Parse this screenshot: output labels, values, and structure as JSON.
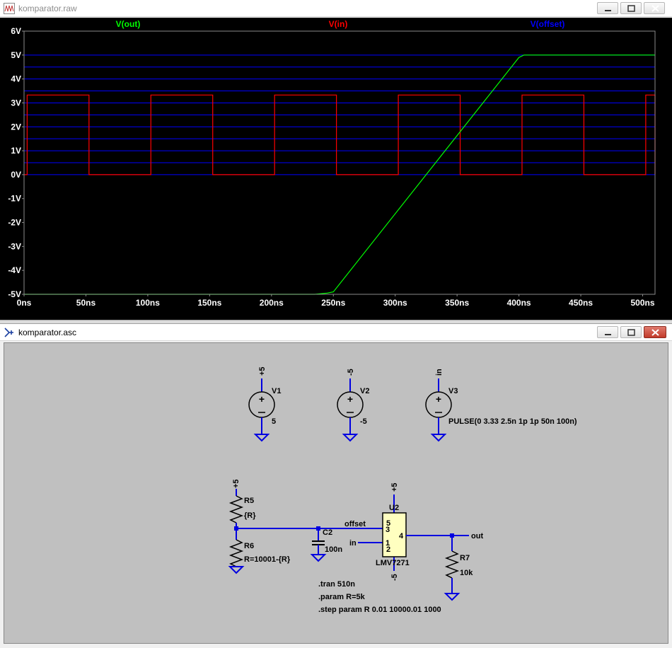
{
  "plot_window": {
    "title": "komparator.raw",
    "title_color": "#8c8c8c"
  },
  "schematic_window": {
    "title": "komparator.asc",
    "title_color": "#000000"
  },
  "chart_data": {
    "type": "line",
    "background": "#000000",
    "grid": "horizontal-only",
    "xlim": [
      0,
      510
    ],
    "ylim": [
      -5,
      6
    ],
    "x_tick_labels": [
      "0ns",
      "50ns",
      "100ns",
      "150ns",
      "200ns",
      "250ns",
      "300ns",
      "350ns",
      "400ns",
      "450ns",
      "500ns"
    ],
    "y_tick_labels": [
      "6V",
      "5V",
      "4V",
      "3V",
      "2V",
      "1V",
      "0V",
      "-1V",
      "-2V",
      "-3V",
      "-4V",
      "-5V"
    ],
    "legend": [
      {
        "label": "V(out)",
        "color": "#00ff00"
      },
      {
        "label": "V(in)",
        "color": "#ff0000"
      },
      {
        "label": "V(offset)",
        "color": "#0000ff"
      }
    ],
    "series": [
      {
        "name": "V(out)",
        "color": "#00ff00",
        "points": [
          [
            0,
            -5
          ],
          [
            235,
            -5
          ],
          [
            245,
            -4.95
          ],
          [
            250,
            -4.9
          ],
          [
            400,
            4.9
          ],
          [
            404,
            5
          ],
          [
            510,
            5
          ]
        ]
      },
      {
        "name": "V(in)",
        "color": "#ff0000",
        "pulse": {
          "v1": 0,
          "v2": 3.33,
          "delay": 2.5,
          "rise": 0,
          "fall": 0,
          "width": 50,
          "period": 100
        }
      },
      {
        "name": "V(offset)",
        "color": "#0000ff",
        "levels": [
          0,
          0.5,
          1,
          1.5,
          2,
          2.5,
          3,
          3.5,
          4,
          4.5,
          5
        ]
      }
    ]
  },
  "schematic": {
    "v1": {
      "name": "V1",
      "value": "5",
      "net": "+5"
    },
    "v2": {
      "name": "V2",
      "value": "-5",
      "net": "-5"
    },
    "v3": {
      "name": "V3",
      "value": "PULSE(0 3.33 2.5n 1p 1p 50n 100n)",
      "net": "in"
    },
    "r5": {
      "name": "R5",
      "value": "{R}",
      "net": "+5"
    },
    "r6": {
      "name": "R6",
      "value": "R=10001-{R}"
    },
    "c2": {
      "name": "C2",
      "value": "100n"
    },
    "u2": {
      "name": "U2",
      "part": "LMV7271",
      "pin_in_plus": "3",
      "pin_in_minus": "1",
      "pin_out": "4",
      "pin_vplus": "5",
      "pin_vminus": "2",
      "net_vplus": "+5",
      "net_vminus": "-5"
    },
    "r7": {
      "name": "R7",
      "value": "10k"
    },
    "nets": {
      "offset": "offset",
      "in": "in",
      "out": "out"
    },
    "directives": [
      ".tran 510n",
      ".param R=5k",
      ".step param R 0.01 10000.01 1000"
    ]
  }
}
